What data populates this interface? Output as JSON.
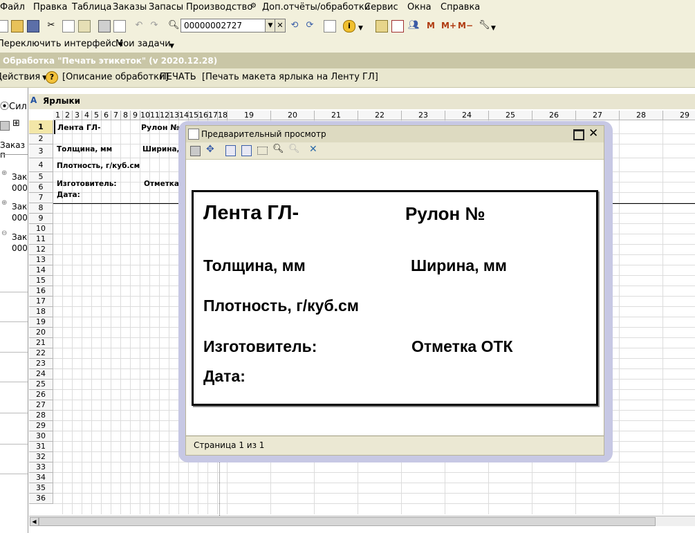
{
  "menu": [
    "Файл",
    "Правка",
    "Таблица",
    "Заказы",
    "Запасы",
    "Производство",
    "Доп.отчёты/обработки",
    "Сервис",
    "Окна",
    "Справка"
  ],
  "toolbar": {
    "search_value": "00000002727"
  },
  "toolbar2": {
    "switch_interface": "Переключить интерфейс",
    "my_tasks": "Мои задачи"
  },
  "window_title": "Обработка \"Печать этикеток\" (v 2020.12.28)",
  "actions": {
    "actions_label": "Действия",
    "help_glyph": "?",
    "description": "[Описание обработки]",
    "print": "ПЕЧАТЬ",
    "print_layout": "[Печать макета ярлыка на Ленту ГЛ]"
  },
  "left_panel": {
    "radio_label": "Сил",
    "order_label": "Заказ п",
    "items": [
      {
        "title": "Зак",
        "code": "000"
      },
      {
        "title": "Зак",
        "code": "000"
      },
      {
        "title": "Зак",
        "code": "000"
      }
    ]
  },
  "sheet": {
    "title": "Ярлыки",
    "col_numbers": [
      "1",
      "2",
      "3",
      "4",
      "5",
      "6",
      "7",
      "8",
      "9",
      "10",
      "11",
      "12",
      "13",
      "14",
      "15",
      "16",
      "17",
      "18",
      "19",
      "20",
      "21",
      "22",
      "23",
      "24",
      "25",
      "26",
      "27",
      "28",
      "29"
    ],
    "row_numbers": [
      "1",
      "2",
      "3",
      "4",
      "5",
      "6",
      "7",
      "8",
      "9",
      "10",
      "11",
      "12",
      "13",
      "14",
      "15",
      "16",
      "17",
      "18",
      "19",
      "20",
      "21",
      "22",
      "23",
      "24",
      "25",
      "26",
      "27",
      "28",
      "29",
      "30",
      "31",
      "32",
      "33",
      "34",
      "35",
      "36"
    ],
    "cells": {
      "tape": "Лента ГЛ-",
      "roll": "Рулон №",
      "thickness": "Толщина, мм",
      "width": "Ширина, мм",
      "density": "Плотность, г/куб.см",
      "maker": "Изготовитель:",
      "otk": "Отметка ОТ",
      "date": "Дата:"
    }
  },
  "preview": {
    "title": "Предварительный просмотр",
    "label": {
      "tape": "Лента ГЛ-",
      "roll": "Рулон №",
      "thickness": "Толщина, мм",
      "width": "Ширина, мм",
      "density": "Плотность, г/куб.см",
      "maker": "Изготовитель:",
      "otk": "Отметка ОТК",
      "date": "Дата:"
    },
    "status": "Страница 1 из 1"
  },
  "colors": {
    "chrome": "#f2f0dc",
    "title": "#c9c6a6",
    "preview_shadow": "#c7c8e4"
  }
}
